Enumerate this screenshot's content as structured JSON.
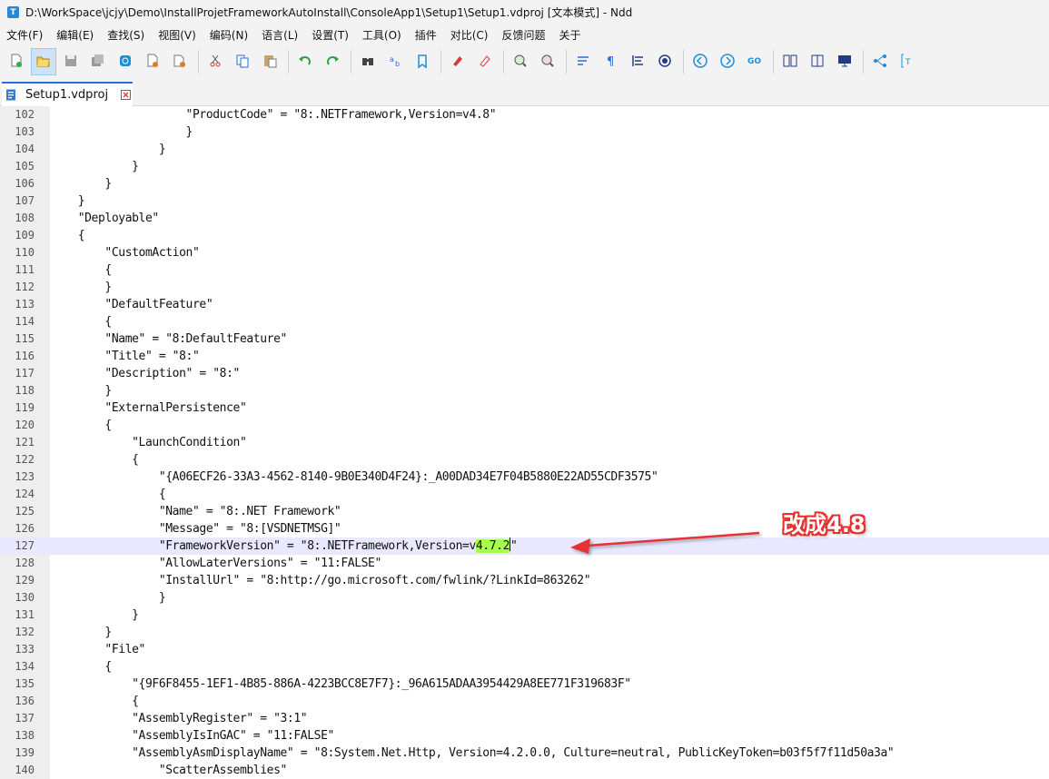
{
  "window": {
    "title": "D:\\WorkSpace\\jcjy\\Demo\\InstallProjetFrameworkAutoInstall\\ConsoleApp1\\Setup1\\Setup1.vdproj [文本模式] - Ndd",
    "app_icon_letter": "T"
  },
  "menu": [
    "文件(F)",
    "编辑(E)",
    "查找(S)",
    "视图(V)",
    "编码(N)",
    "语言(L)",
    "设置(T)",
    "工具(O)",
    "插件",
    "对比(C)",
    "反馈问题",
    "关于"
  ],
  "toolbar": {
    "groups": [
      [
        "new-file-icon",
        "open-folder-icon",
        "save-icon",
        "save-all-icon",
        "reload-icon",
        "close-file-icon",
        "close-all-icon"
      ],
      [
        "cut-icon",
        "copy-icon",
        "paste-icon"
      ],
      [
        "undo-icon",
        "redo-icon"
      ],
      [
        "find-icon",
        "replace-icon",
        "bookmark-icon"
      ],
      [
        "marker-icon",
        "clear-marker-icon"
      ],
      [
        "zoom-in-icon",
        "zoom-out-icon"
      ],
      [
        "word-wrap-icon",
        "show-symbols-icon",
        "indent-guide-icon",
        "record-icon"
      ],
      [
        "prev-icon",
        "next-icon",
        "goto-icon"
      ],
      [
        "compare-icon",
        "diff-icon",
        "monitor-icon"
      ],
      [
        "tree-icon",
        "text-mode-icon"
      ]
    ]
  },
  "tab": {
    "label": "Setup1.vdproj"
  },
  "editor": {
    "current_line": 127,
    "lines": [
      {
        "n": "102",
        "text": "                    \"ProductCode\" = \"8:.NETFramework,Version=v4.8\""
      },
      {
        "n": "103",
        "text": "                    }"
      },
      {
        "n": "104",
        "text": "                }"
      },
      {
        "n": "105",
        "text": "            }"
      },
      {
        "n": "106",
        "text": "        }"
      },
      {
        "n": "107",
        "text": "    }"
      },
      {
        "n": "108",
        "text": "    \"Deployable\""
      },
      {
        "n": "109",
        "text": "    {"
      },
      {
        "n": "110",
        "text": "        \"CustomAction\""
      },
      {
        "n": "111",
        "text": "        {"
      },
      {
        "n": "112",
        "text": "        }"
      },
      {
        "n": "113",
        "text": "        \"DefaultFeature\""
      },
      {
        "n": "114",
        "text": "        {"
      },
      {
        "n": "115",
        "text": "        \"Name\" = \"8:DefaultFeature\""
      },
      {
        "n": "116",
        "text": "        \"Title\" = \"8:\""
      },
      {
        "n": "117",
        "text": "        \"Description\" = \"8:\""
      },
      {
        "n": "118",
        "text": "        }"
      },
      {
        "n": "119",
        "text": "        \"ExternalPersistence\""
      },
      {
        "n": "120",
        "text": "        {"
      },
      {
        "n": "121",
        "text": "            \"LaunchCondition\""
      },
      {
        "n": "122",
        "text": "            {"
      },
      {
        "n": "123",
        "text": "                \"{A06ECF26-33A3-4562-8140-9B0E340D4F24}:_A00DAD34E7F04B5880E22AD55CDF3575\""
      },
      {
        "n": "124",
        "text": "                {"
      },
      {
        "n": "125",
        "text": "                \"Name\" = \"8:.NET Framework\""
      },
      {
        "n": "126",
        "text": "                \"Message\" = \"8:[VSDNETMSG]\""
      },
      {
        "n": "127",
        "pre": "                \"FrameworkVersion\" = \"8:.NETFramework,Version=v",
        "hl": "4.7.2",
        "post": "\""
      },
      {
        "n": "128",
        "text": "                \"AllowLaterVersions\" = \"11:FALSE\""
      },
      {
        "n": "129",
        "text": "                \"InstallUrl\" = \"8:http://go.microsoft.com/fwlink/?LinkId=863262\""
      },
      {
        "n": "130",
        "text": "                }"
      },
      {
        "n": "131",
        "text": "            }"
      },
      {
        "n": "132",
        "text": "        }"
      },
      {
        "n": "133",
        "text": "        \"File\""
      },
      {
        "n": "134",
        "text": "        {"
      },
      {
        "n": "135",
        "text": "            \"{9F6F8455-1EF1-4B85-886A-4223BCC8E7F7}:_96A615ADAA3954429A8EE771F319683F\""
      },
      {
        "n": "136",
        "text": "            {"
      },
      {
        "n": "137",
        "text": "            \"AssemblyRegister\" = \"3:1\""
      },
      {
        "n": "138",
        "text": "            \"AssemblyIsInGAC\" = \"11:FALSE\""
      },
      {
        "n": "139",
        "text": "            \"AssemblyAsmDisplayName\" = \"8:System.Net.Http, Version=4.2.0.0, Culture=neutral, PublicKeyToken=b03f5f7f11d50a3a\""
      },
      {
        "n": "140",
        "text": "                \"ScatterAssemblies\""
      }
    ]
  },
  "annotation": {
    "text": "改成4.8",
    "color": "#e63030"
  }
}
